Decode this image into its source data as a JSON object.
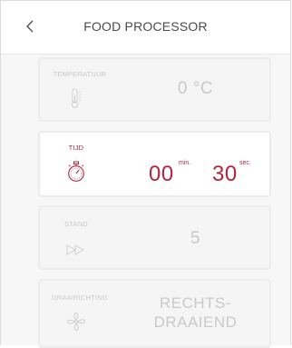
{
  "header": {
    "title": "FOOD PROCESSOR",
    "back_icon": "chevron-left-icon"
  },
  "settings": {
    "temperature": {
      "label": "TEMPERATUUR",
      "value": "0 °C",
      "icon": "thermometer-icon",
      "active": false
    },
    "time": {
      "label": "TIJD",
      "minutes": "00",
      "minutes_unit": "min.",
      "seconds": "30",
      "seconds_unit": "sec.",
      "icon": "stopwatch-icon",
      "active": true
    },
    "speed": {
      "label": "STAND",
      "value": "5",
      "icon": "fast-forward-icon",
      "active": false
    },
    "direction": {
      "label": "DRAAIRICHTING",
      "value_line1": "RECHTS-",
      "value_line2": "DRAAIEND",
      "icon": "fan-icon",
      "active": false
    }
  },
  "colors": {
    "accent": "#b5243e",
    "inactive_text": "#c9c9c9",
    "background": "#f7f7f7"
  }
}
